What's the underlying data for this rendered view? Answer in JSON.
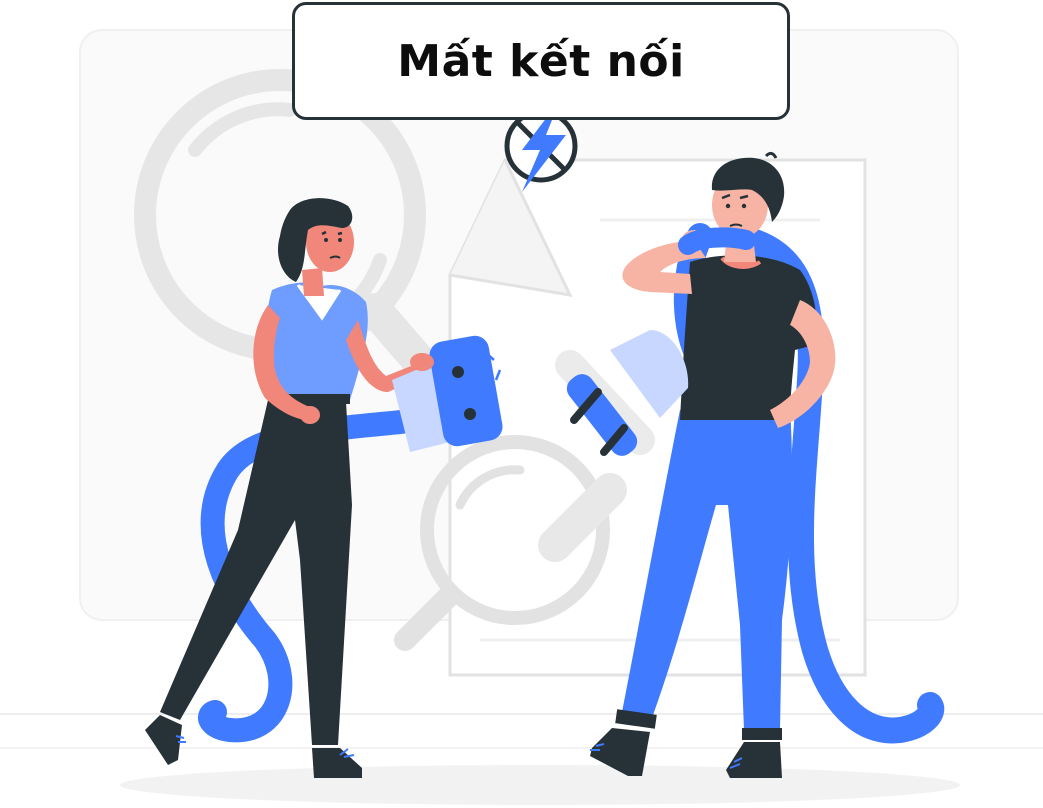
{
  "status": {
    "title": "Mất kết nối"
  },
  "icons": {
    "status_icon": "no-power-icon"
  },
  "colors": {
    "accent": "#407BFF",
    "accent_light": "#C7D7FF",
    "dark": "#263238",
    "skin": "#F0877A",
    "skin_light": "#FBC4B6",
    "background_shapes": "#EBEBEB",
    "background_lines": "#E0E0E0"
  }
}
